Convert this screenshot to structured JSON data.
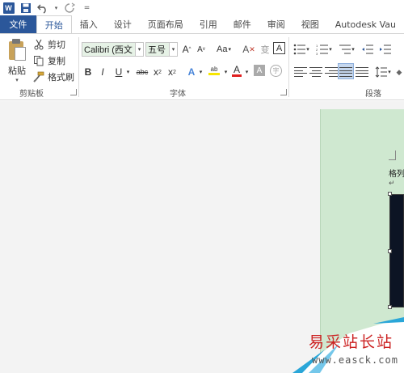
{
  "app": {
    "logo_letter": "W",
    "accent": "#2b579a"
  },
  "quick_access": {
    "icons": [
      "word-icon",
      "save-icon",
      "undo-icon",
      "redo-icon",
      "customize-icon"
    ],
    "customize_glyph": "="
  },
  "tabs": [
    {
      "label": "文件"
    },
    {
      "label": "开始"
    },
    {
      "label": "插入"
    },
    {
      "label": "设计"
    },
    {
      "label": "页面布局"
    },
    {
      "label": "引用"
    },
    {
      "label": "邮件"
    },
    {
      "label": "审阅"
    },
    {
      "label": "视图"
    },
    {
      "label": "Autodesk Vau"
    }
  ],
  "clipboard": {
    "paste_label": "粘贴",
    "cut_label": "剪切",
    "copy_label": "复制",
    "format_painter_label": "格式刷",
    "group_label": "剪贴板"
  },
  "font": {
    "font_name": "Calibri (西文",
    "font_size": "五号",
    "grow_label": "A",
    "shrink_label": "A",
    "case_label": "Aa",
    "clear_label": "A",
    "phonetic_label": "变",
    "border_label": "A",
    "bold_label": "B",
    "italic_label": "I",
    "underline_label": "U",
    "strike_label": "abc",
    "subscript_label": "x",
    "superscript_label": "x",
    "sub_index": "2",
    "super_index": "2",
    "effects_label": "A",
    "highlight_label": "ab",
    "color_label": "A",
    "shading_label": "A",
    "enclose_label": "字",
    "group_label": "字体"
  },
  "paragraph": {
    "group_label": "段落"
  },
  "document": {
    "visible_text": "格列",
    "para_mark": "↵"
  },
  "watermark": {
    "title": "易采站长站",
    "url": "www.easck.com"
  }
}
